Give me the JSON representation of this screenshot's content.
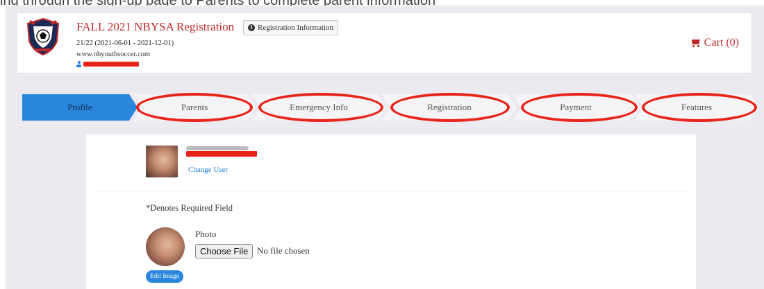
{
  "top_caption": "ing through the sign-up page to Parents to complete parent information",
  "header": {
    "title": "FALL 2021 NBYSA Registration",
    "info_button": "Registration Information",
    "season": "21/22 (2021-06-01 - 2021-12-01)",
    "website": "www.nbyouthsoccer.com",
    "cart": "Cart (0)"
  },
  "steps": [
    {
      "label": "Profile",
      "active": true
    },
    {
      "label": "Parents",
      "active": false
    },
    {
      "label": "Emergency Info",
      "active": false
    },
    {
      "label": "Registration",
      "active": false
    },
    {
      "label": "Payment",
      "active": false
    },
    {
      "label": "Features",
      "active": false
    }
  ],
  "profile": {
    "change_user": "Change User",
    "required_note": "*Denotes Required Field",
    "photo_label": "Photo",
    "choose_file": "Choose File",
    "file_status": "No file chosen",
    "edit_image": "Edit Image"
  },
  "colors": {
    "brand_red": "#c0282a",
    "active_step": "#2a86dc",
    "highlight_ring": "#e8231a",
    "link_blue": "#1f7fe0"
  },
  "icons": [
    "info-icon",
    "user-icon",
    "cart-icon"
  ]
}
